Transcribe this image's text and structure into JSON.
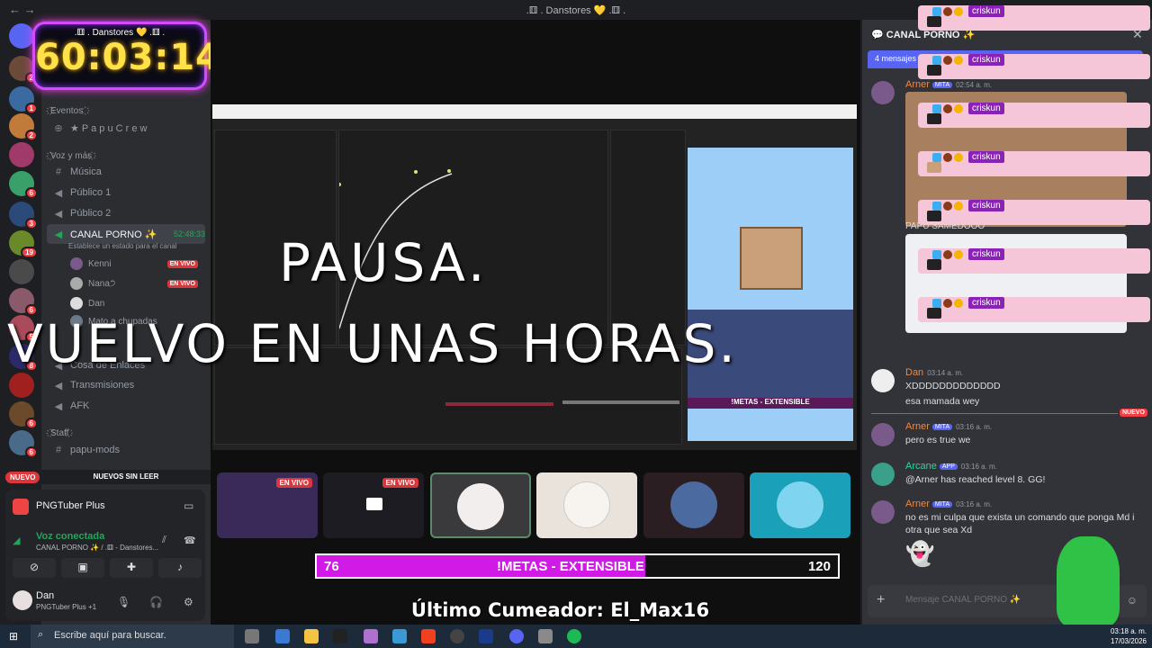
{
  "window": {
    "title": ".⚅ . Danstores 💛 .⚅ ."
  },
  "timer": {
    "subtitle": ".⚅ . Danstores 💛 .⚅ .",
    "value": "60:03:14"
  },
  "sidebar": {
    "categories": [
      "҉Eventos ҉",
      "҉Voz y más҉",
      "҉Staff҉"
    ],
    "papu_crew": "★ P a p u C r e w",
    "channels": [
      {
        "name": "Música",
        "icon": "speaker"
      },
      {
        "name": "Público 1",
        "icon": "speaker"
      },
      {
        "name": "Público 2",
        "icon": "speaker"
      },
      {
        "name": "Cosa de Enlaces",
        "icon": "speaker"
      },
      {
        "name": "Transmisiones",
        "icon": "speaker"
      },
      {
        "name": "AFK",
        "icon": "speaker"
      },
      {
        "name": "papu-mods",
        "icon": "hash"
      }
    ],
    "active_voice": {
      "name": "CANAL PORNO ✨",
      "timer": "52:48:33",
      "status": "Establece un estado para el canal"
    },
    "voice_users": [
      {
        "name": "Kenni",
        "live": "EN VIVO"
      },
      {
        "name": "Nana੭",
        "live": "EN VIVO"
      },
      {
        "name": "Dan",
        "live": ""
      },
      {
        "name": "Mato a chupadas",
        "live": ""
      }
    ],
    "nuevo_badge": "NUEVO",
    "unread_banner": "NUEVOS SIN LEER"
  },
  "voice_panel": {
    "app_name": "PNGTuber Plus",
    "status": "Voz conectada",
    "channel": "CANAL PORNO ✨ / .⚅ - Danstores...",
    "user_name": "Dan",
    "user_status": "PNGTuber Plus +1"
  },
  "overlay": {
    "line1": "PAUSA.",
    "line2": "VUELVO EN UNAS HORAS."
  },
  "tiles": [
    {
      "live": "EN VIVO"
    },
    {
      "live": "EN VIVO"
    },
    {
      "live": ""
    },
    {
      "live": ""
    },
    {
      "live": ""
    },
    {
      "live": ""
    }
  ],
  "metas": {
    "left": "76",
    "label": "!METAS - EXTENSIBLE",
    "right": "120",
    "progress": 0.63
  },
  "last_cum": "Último Cumeador: El_Max16",
  "chat": {
    "channel": "CANAL PORNO ✨",
    "new_messages": "4 mensajes",
    "nuevo": "NUEVO",
    "papu_text": "PAPU SAMEDOOO",
    "pink_label": "criskun",
    "messages": [
      {
        "author": "Arner",
        "tag": "MITA",
        "time": "02:54 a. m.",
        "body": ""
      },
      {
        "author": "Dan",
        "tag": "",
        "time": "03:14 a. m.",
        "body": "XDDDDDDDDDDDDD"
      },
      {
        "author": "",
        "tag": "",
        "time": "",
        "body": "esa mamada wey"
      },
      {
        "author": "Arner",
        "tag": "MITA",
        "time": "03:16 a. m.",
        "body": "pero es true we"
      },
      {
        "author": "Arcane",
        "tag": "APP",
        "time": "03:16 a. m.",
        "body": "@Arner has reached level 8. GG!"
      },
      {
        "author": "Arner",
        "tag": "MITA",
        "time": "03:16 a. m.",
        "body": "no es mi culpa que exista un comando que ponga Md i otra que sea Xd"
      }
    ],
    "input_placeholder": "Mensaje CANAL PORNO ✨"
  },
  "taskbar": {
    "search_placeholder": "Escribe aquí para buscar.",
    "time": "03:18 a. m.",
    "date": "17/03/2026"
  },
  "colors": {
    "accent": "#5865f2",
    "live": "#da373c",
    "metas": "#d21ae6",
    "timer": "#ffe14a"
  }
}
